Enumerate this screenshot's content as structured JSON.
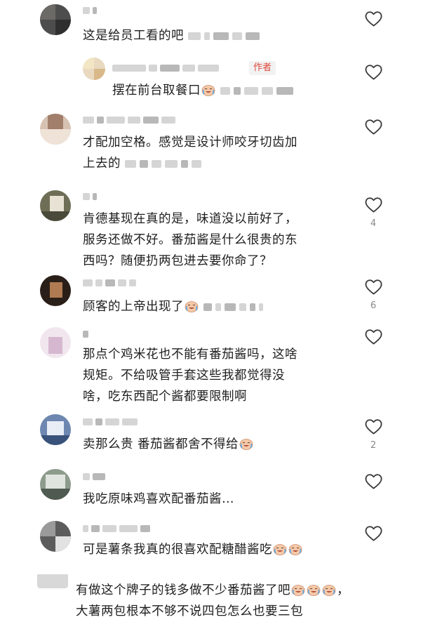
{
  "comments": [
    {
      "text": "这是给员工看的吧",
      "likes": ""
    },
    {
      "text": "摆在前台取餐口",
      "author_tag": "作者",
      "likes": ""
    },
    {
      "line1": "才配加空格。感觉是设计师咬牙切齿加",
      "line2": "上去的",
      "likes": ""
    },
    {
      "line1": "肯德基现在真的是，味道没以前好了，",
      "line2": "服务还做不好。番茄酱是什么很贵的东",
      "line3": "西吗？随便扔两包进去要你命了？",
      "likes": "4"
    },
    {
      "text": "顾客的上帝出现了",
      "likes": "6"
    },
    {
      "line1": "那点个鸡米花也不能有番茄酱吗，这啥",
      "line2": "规矩。不给吸管手套这些我都觉得没",
      "line3": "啥，吃东西配个酱都要限制啊",
      "likes": ""
    },
    {
      "text": "卖那么贵 番茄酱都舍不得给",
      "likes": "2"
    },
    {
      "text": "我吃原味鸡喜欢配番茄酱…",
      "likes": ""
    },
    {
      "text": "可是薯条我真的很喜欢配糖醋酱吃",
      "likes": ""
    },
    {
      "line1": "有做这个牌子的钱多做不少番茄酱了吧",
      "line1_end": "，",
      "line2": "大薯两包根本不够不说四包怎么也要三包"
    }
  ],
  "icons": {
    "like": "heart-outline-icon",
    "emoji": "crying-laughing-emoji-icon"
  },
  "colors": {
    "author_tag": "#e0473a",
    "count": "#888888"
  }
}
